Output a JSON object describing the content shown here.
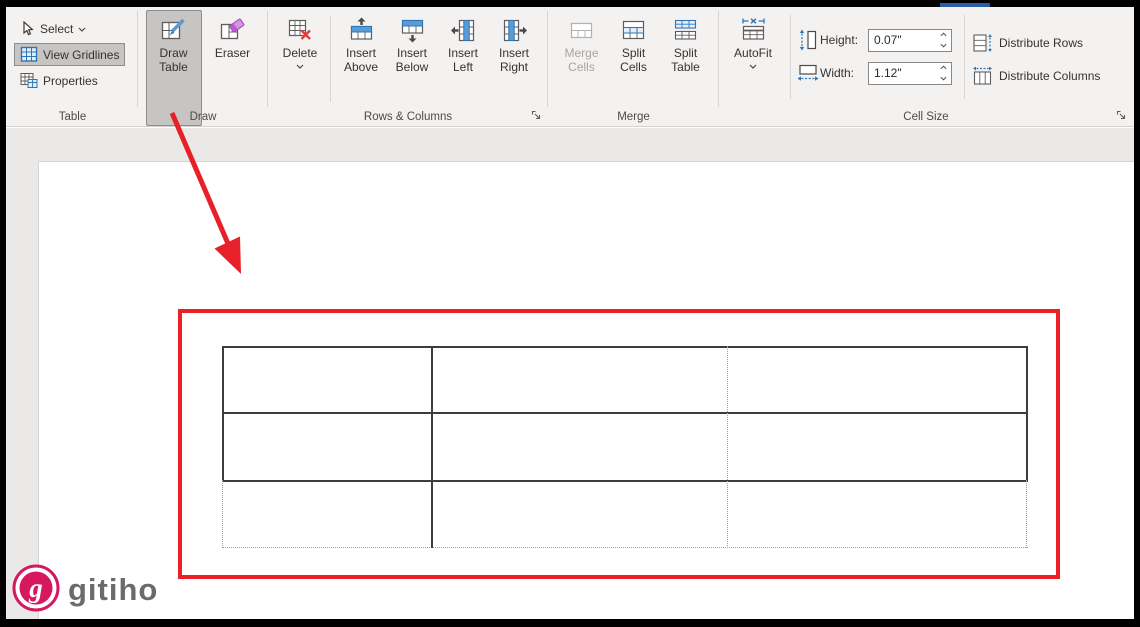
{
  "colors": {
    "annotation_red": "#ec2027",
    "logo_pink": "#d6195f",
    "tab_underline_blue": "#2a5ca8",
    "pressed_button_gray": "#c7c5c3",
    "ribbon_background": "#f3f2f1"
  },
  "ribbon": {
    "table_group": {
      "label": "Table",
      "select_label": "Select",
      "view_gridlines_label": "View Gridlines",
      "properties_label": "Properties"
    },
    "draw_group": {
      "label": "Draw",
      "draw_table_label": "Draw Table",
      "eraser_label": "Eraser"
    },
    "rows_columns_group": {
      "label": "Rows & Columns",
      "delete_label": "Delete",
      "insert_above_label": "Insert Above",
      "insert_below_label": "Insert Below",
      "insert_left_label": "Insert Left",
      "insert_right_label": "Insert Right"
    },
    "merge_group": {
      "label": "Merge",
      "merge_cells_label": "Merge Cells",
      "split_cells_label": "Split Cells",
      "split_table_label": "Split Table"
    },
    "cell_size_group": {
      "label": "Cell Size",
      "autofit_label": "AutoFit",
      "height_label": "Height:",
      "height_value": "0.07\"",
      "width_label": "Width:",
      "width_value": "1.12\"",
      "distribute_rows_label": "Distribute Rows",
      "distribute_columns_label": "Distribute Columns"
    }
  },
  "document": {
    "table": {
      "rows": 3,
      "columns": 3
    }
  },
  "logo": {
    "text": "gitiho"
  }
}
